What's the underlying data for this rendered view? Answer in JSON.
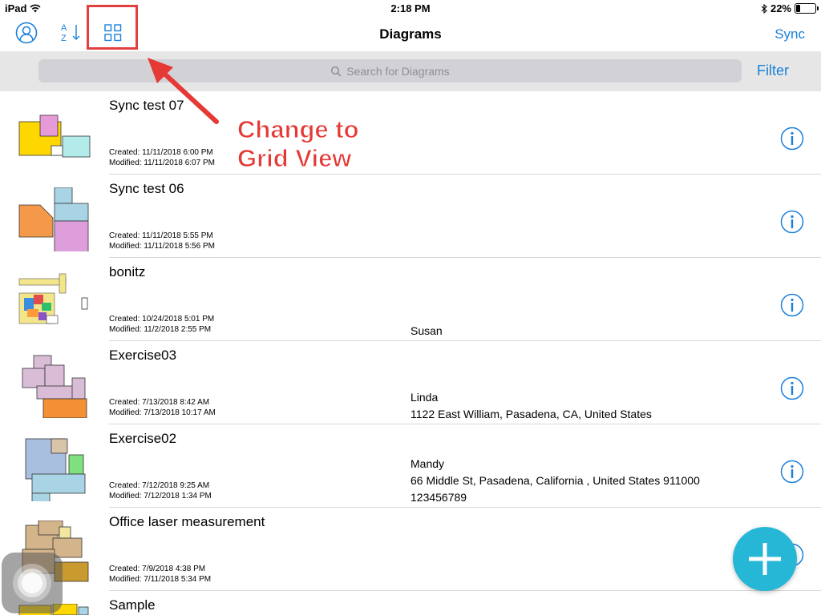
{
  "status_bar": {
    "device": "iPad",
    "time": "2:18 PM",
    "battery": "22%"
  },
  "nav": {
    "title": "Diagrams",
    "sync_label": "Sync",
    "icons": [
      "profile-icon",
      "sort-az-icon",
      "grid-view-icon"
    ]
  },
  "search": {
    "placeholder": "Search for Diagrams",
    "filter_label": "Filter"
  },
  "diagrams": [
    {
      "title": "Sync test 07",
      "created": "Created: 11/11/2018 6:00 PM",
      "modified": "Modified: 11/11/2018 6:07 PM",
      "meta": []
    },
    {
      "title": "Sync test 06",
      "created": "Created: 11/11/2018 5:55 PM",
      "modified": "Modified: 11/11/2018 5:56 PM",
      "meta": []
    },
    {
      "title": "bonitz",
      "created": "Created: 10/24/2018 5:01 PM",
      "modified": "Modified: 11/2/2018 2:55 PM",
      "meta": [
        "Susan"
      ]
    },
    {
      "title": "Exercise03",
      "created": "Created: 7/13/2018 8:42 AM",
      "modified": "Modified: 7/13/2018 10:17 AM",
      "meta": [
        "Linda",
        "1122 East William, Pasadena, CA, United States"
      ]
    },
    {
      "title": "Exercise02",
      "created": "Created: 7/12/2018 9:25 AM",
      "modified": "Modified: 7/12/2018 1:34 PM",
      "meta": [
        "Mandy",
        "66 Middle St, Pasadena, California , United States 911000",
        "123456789"
      ]
    },
    {
      "title": "Office laser measurement",
      "created": "Created: 7/9/2018 4:38 PM",
      "modified": "Modified: 7/11/2018 5:34 PM",
      "meta": []
    },
    {
      "title": "Sample",
      "created": "",
      "modified": "",
      "meta": []
    }
  ],
  "annotation": {
    "line1": "Change to",
    "line2": "Grid View",
    "color": "#e53935"
  },
  "colors": {
    "accent": "#1a80d9",
    "fab": "#27b7d6",
    "highlight": "#e2403f"
  }
}
